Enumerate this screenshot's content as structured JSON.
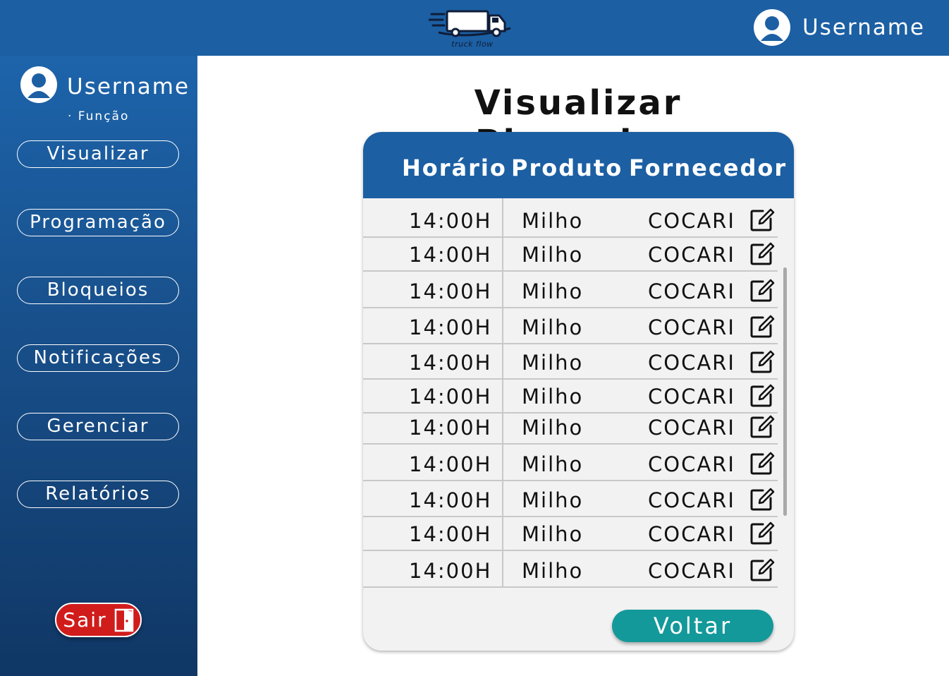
{
  "header": {
    "logo_text": "truck flow",
    "username": "Username",
    "logo_icon": "truck-icon",
    "avatar_icon": "user-avatar-icon"
  },
  "sidebar": {
    "username": "Username",
    "role": "· Função",
    "items": [
      {
        "label": "Visualizar"
      },
      {
        "label": "Programação"
      },
      {
        "label": "Bloqueios"
      },
      {
        "label": "Notificações"
      },
      {
        "label": "Gerenciar"
      },
      {
        "label": "Relatórios"
      }
    ],
    "logout_label": "Sair",
    "logout_icon": "door-icon"
  },
  "main": {
    "title": "Visualizar Bloqueios",
    "table": {
      "columns": [
        "Horário",
        "Produto",
        "Fornecedor"
      ],
      "rows": [
        [
          "14:00H",
          "Milho",
          "COCARI"
        ],
        [
          "14:00H",
          "Milho",
          "COCARI"
        ],
        [
          "14:00H",
          "Milho",
          "COCARI"
        ],
        [
          "14:00H",
          "Milho",
          "COCARI"
        ],
        [
          "14:00H",
          "Milho",
          "COCARI"
        ],
        [
          "14:00H",
          "Milho",
          "COCARI"
        ],
        [
          "14:00H",
          "Milho",
          "COCARI"
        ],
        [
          "14:00H",
          "Milho",
          "COCARI"
        ],
        [
          "14:00H",
          "Milho",
          "COCARI"
        ],
        [
          "14:00H",
          "Milho",
          "COCARI"
        ],
        [
          "14:00H",
          "Milho",
          "COCARI"
        ]
      ],
      "row_action_icon": "edit-icon"
    },
    "back_label": "Voltar"
  },
  "colors": {
    "primary": "#1c5fa3",
    "sidebar_dark": "#103765",
    "danger": "#d11c1c",
    "accent": "#13999a",
    "card_bg": "#f2f2f2"
  }
}
